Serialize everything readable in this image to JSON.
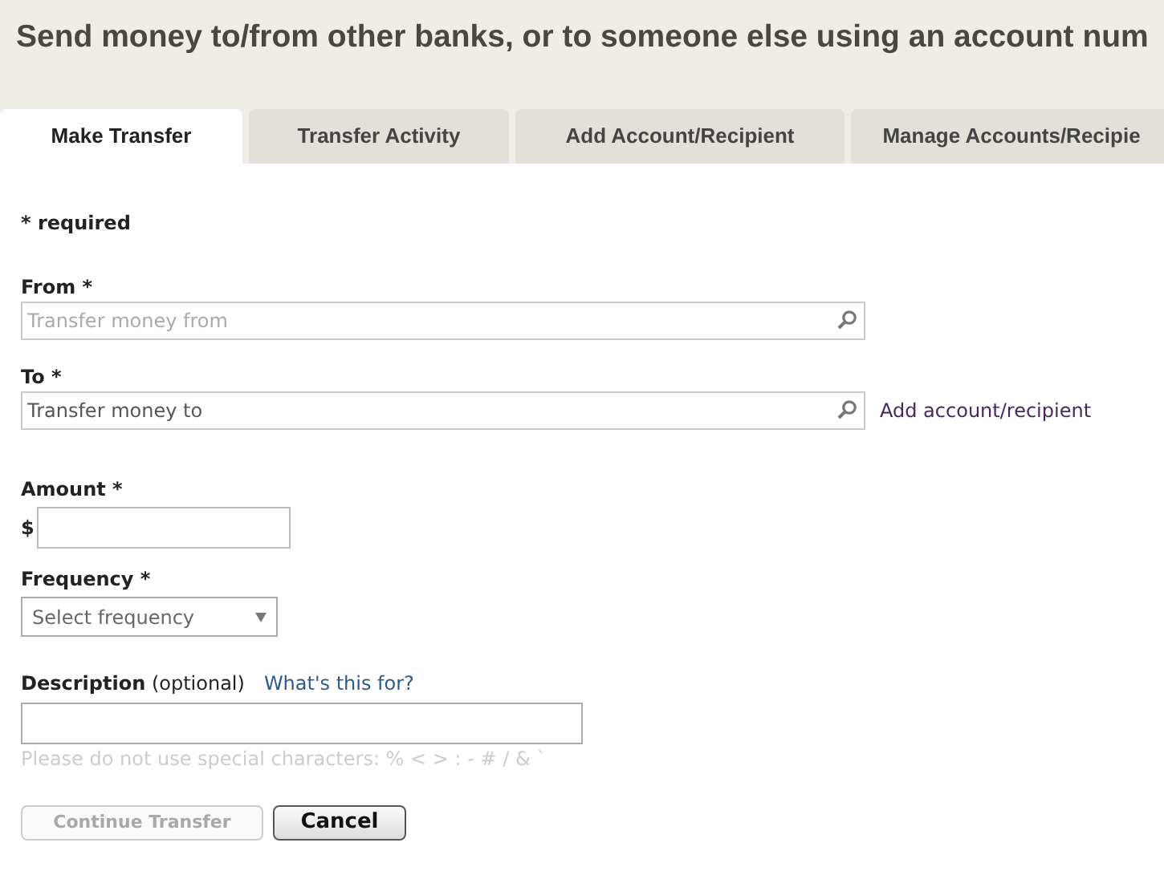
{
  "title": "Send money to/from other banks, or to someone else using an account num",
  "tabs": [
    {
      "label": "Make Transfer",
      "selected": true
    },
    {
      "label": "Transfer Activity",
      "selected": false
    },
    {
      "label": "Add Account/Recipient",
      "selected": false
    },
    {
      "label": "Manage Accounts/Recipie",
      "selected": false
    }
  ],
  "required_note": "* required",
  "from": {
    "label": "From *",
    "placeholder": "Transfer money from"
  },
  "to": {
    "label": "To *",
    "value": "Transfer money to",
    "link": "Add account/recipient"
  },
  "amount": {
    "label": "Amount *",
    "currency": "$"
  },
  "frequency": {
    "label": "Frequency *",
    "placeholder": "Select frequency"
  },
  "description": {
    "label": "**Description** (optional)",
    "link": "What's this for?",
    "hint": "Please do not use special characters: % < > : - # / & `"
  },
  "buttons": [
    {
      "label": "Continue Transfer",
      "disabled": true
    },
    {
      "label": "Cancel",
      "disabled": false
    }
  ]
}
